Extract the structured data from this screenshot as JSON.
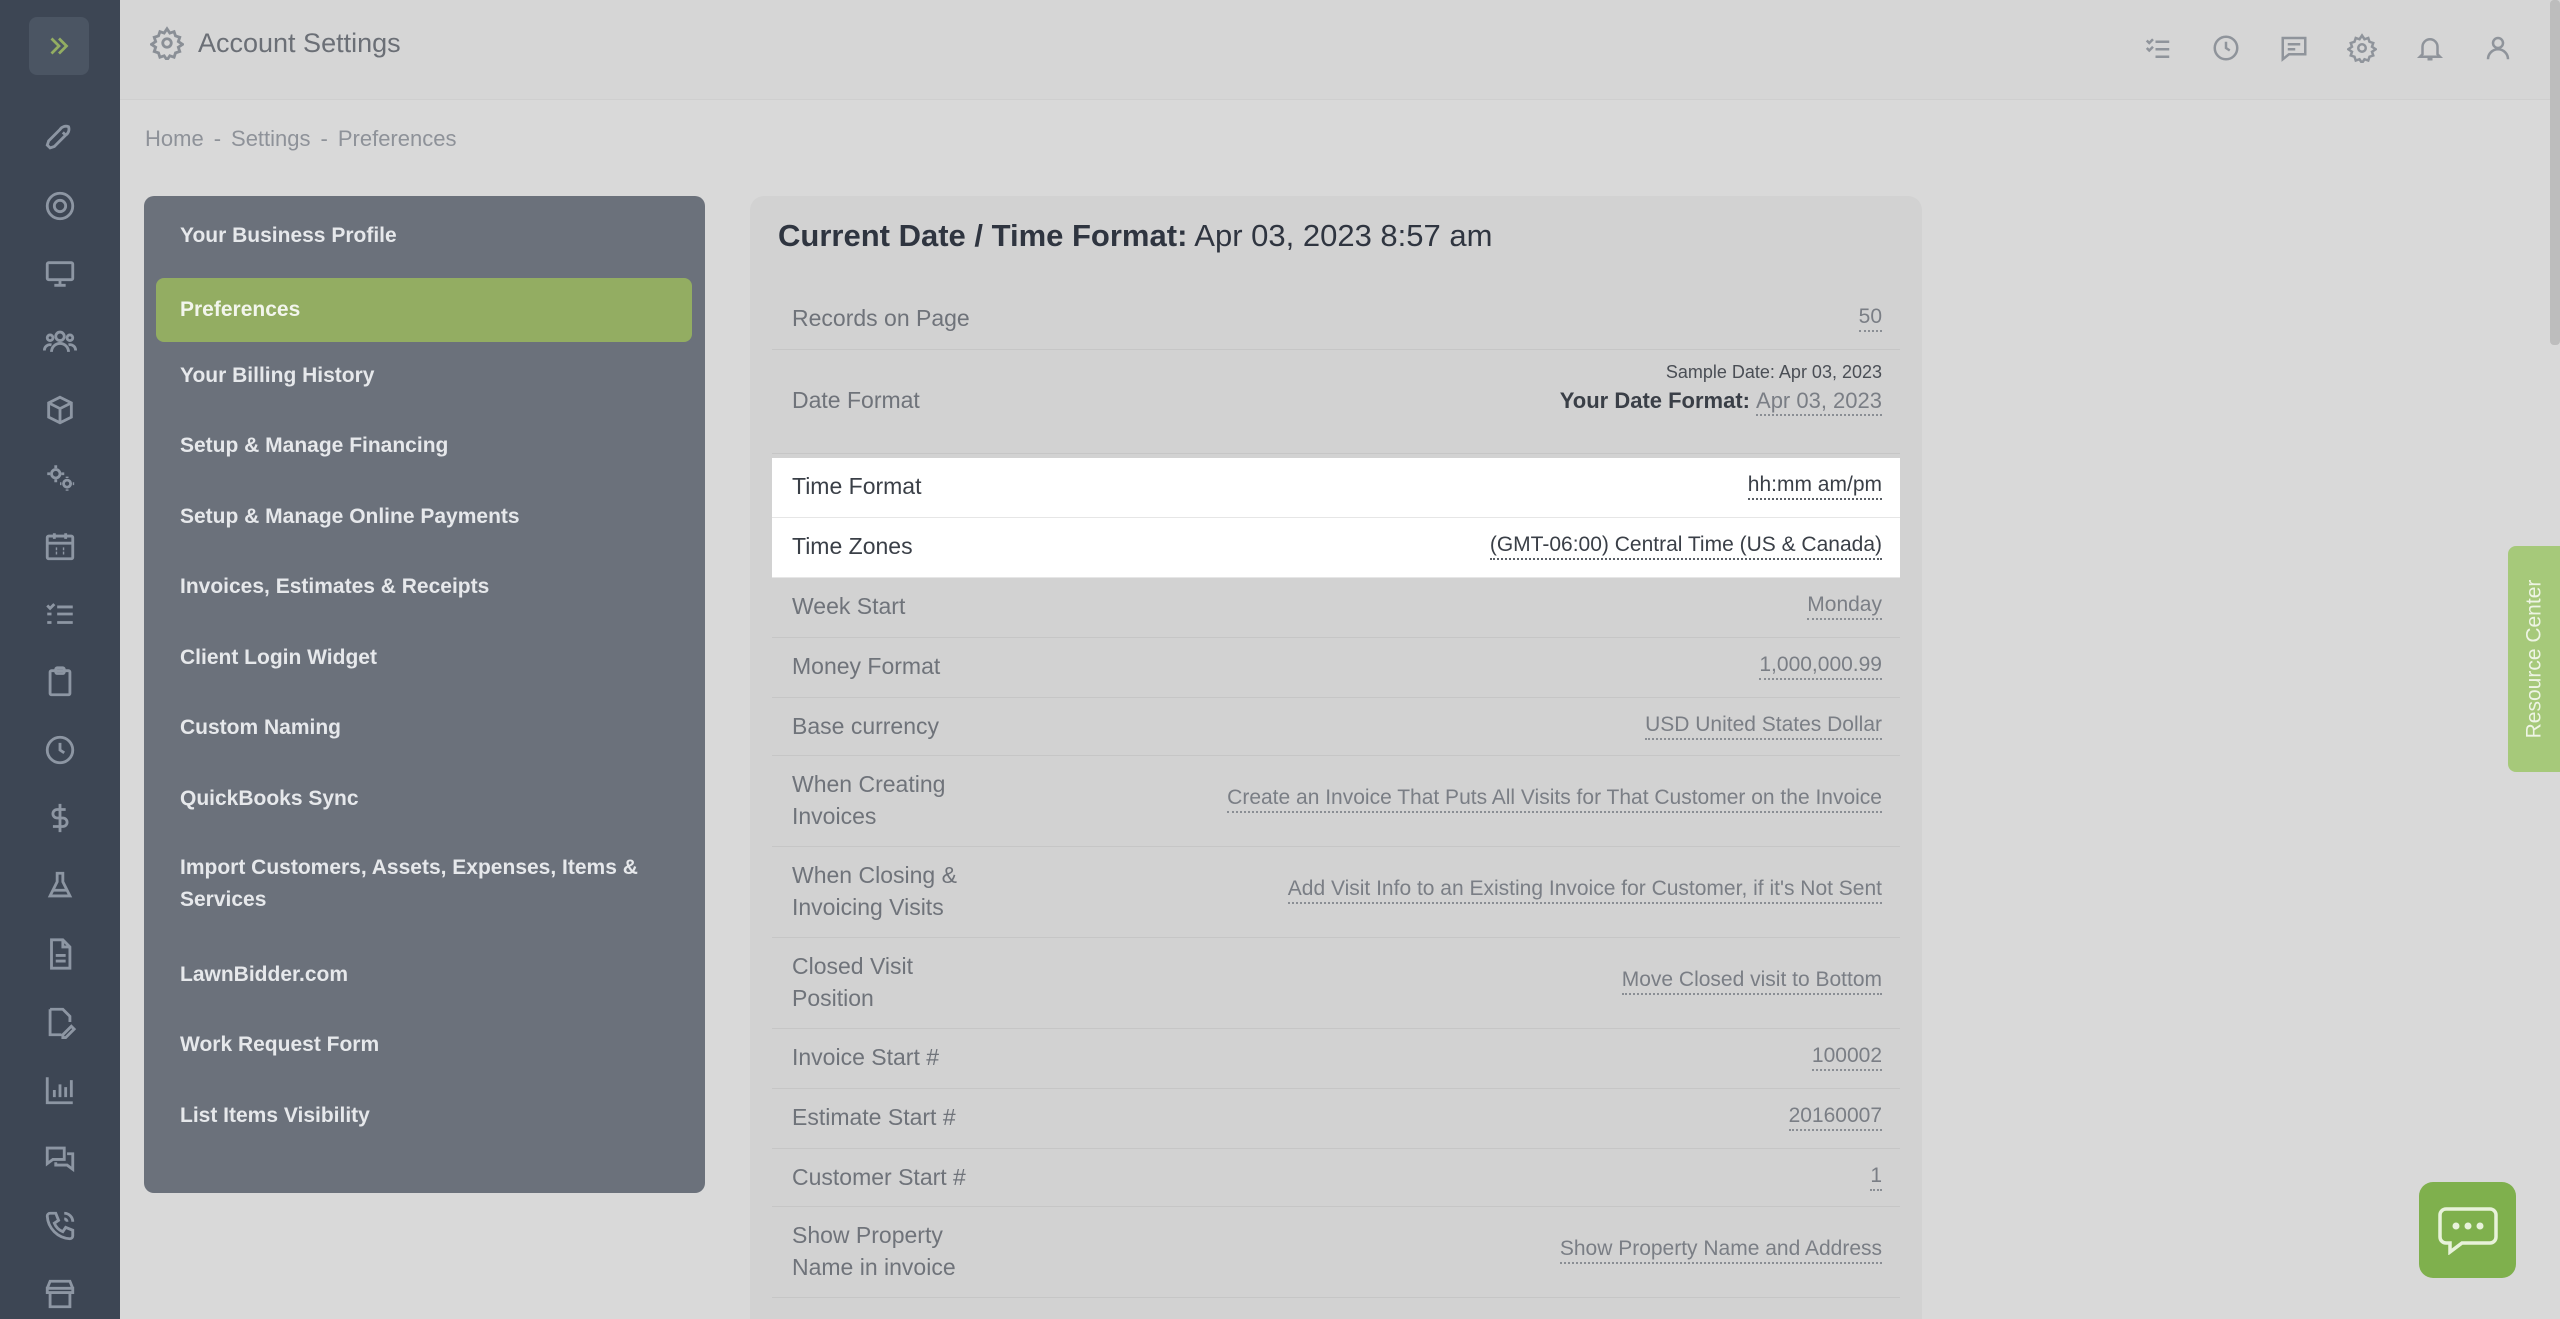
{
  "header": {
    "title": "Account Settings"
  },
  "breadcrumb": {
    "home": "Home",
    "settings": "Settings",
    "current": "Preferences",
    "sep": "-"
  },
  "settings_nav": {
    "items": [
      {
        "label": "Your Business Profile"
      },
      {
        "label": "Preferences",
        "active": true
      },
      {
        "label": "Your Billing History"
      },
      {
        "label": "Setup & Manage Financing"
      },
      {
        "label": "Setup & Manage Online Payments"
      },
      {
        "label": "Invoices, Estimates & Receipts"
      },
      {
        "label": "Client Login Widget"
      },
      {
        "label": "Custom Naming"
      },
      {
        "label": "QuickBooks Sync"
      },
      {
        "label": "Import Customers, Assets, Expenses, Items & Services"
      },
      {
        "label": "LawnBidder.com"
      },
      {
        "label": "Work Request Form"
      },
      {
        "label": "List Items Visibility"
      }
    ]
  },
  "preferences": {
    "title_label": "Current Date / Time Format:",
    "title_value": "Apr 03, 2023 8:57 am",
    "records_on_page": {
      "label": "Records on Page",
      "value": "50"
    },
    "date_format": {
      "label": "Date Format",
      "sample": "Sample Date: Apr 03, 2023",
      "your_label": "Your Date Format:",
      "your_value": "Apr 03, 2023"
    },
    "time_format": {
      "label": "Time Format",
      "value": "hh:mm am/pm"
    },
    "time_zones": {
      "label": "Time Zones",
      "value": "(GMT-06:00) Central Time (US & Canada)"
    },
    "week_start": {
      "label": "Week Start",
      "value": "Monday"
    },
    "money_format": {
      "label": "Money Format",
      "value": "1,000,000.99"
    },
    "base_currency": {
      "label": "Base currency",
      "value": "USD United States Dollar"
    },
    "creating_invoices": {
      "label_1": "When Creating",
      "label_2": "Invoices",
      "value": "Create an Invoice That Puts All Visits for That Customer on the Invoice"
    },
    "closing_visits": {
      "label_1": "When Closing &",
      "label_2": "Invoicing Visits",
      "value": "Add Visit Info to an Existing Invoice for Customer, if it's Not Sent"
    },
    "closed_visit_position": {
      "label_1": "Closed Visit",
      "label_2": "Position",
      "value": "Move Closed visit to Bottom"
    },
    "invoice_start": {
      "label": "Invoice Start #",
      "value": "100002"
    },
    "estimate_start": {
      "label": "Estimate Start #",
      "value": "20160007"
    },
    "customer_start": {
      "label": "Customer Start #",
      "value": "1"
    },
    "show_property": {
      "label_1": "Show Property",
      "label_2": "Name in invoice",
      "value": "Show Property Name and Address"
    }
  },
  "resource_center": {
    "label": "Resource Center"
  },
  "colors": {
    "accent_green": "#93ad62",
    "nav_bg": "#6b717b",
    "rail_bg": "#3d4654"
  }
}
